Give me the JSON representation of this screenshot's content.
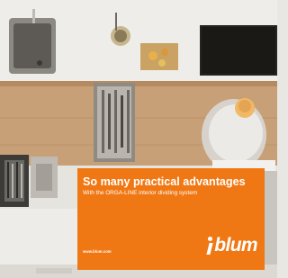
{
  "panel": {
    "title": "So many practical advantages",
    "subtitle": "With the ORGA-LINE interior dividing system",
    "url": "www.blum.com",
    "brand": "blum",
    "color": "#f07814"
  }
}
